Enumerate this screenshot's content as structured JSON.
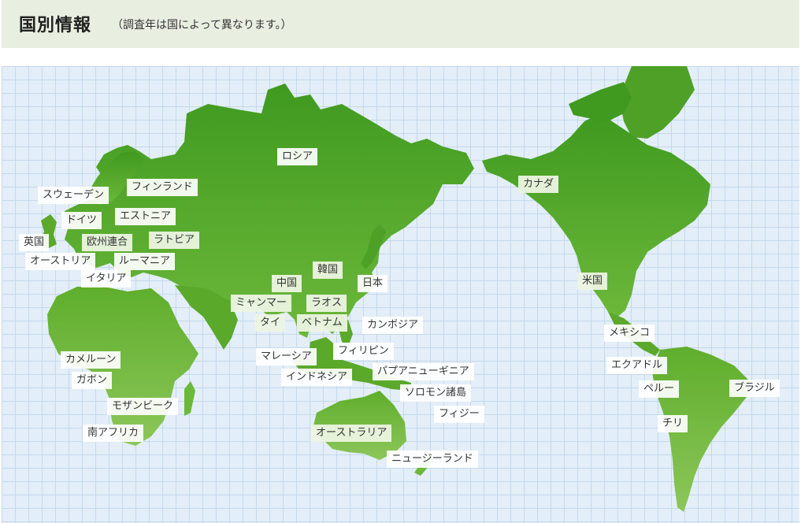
{
  "header": {
    "title": "国別情報",
    "subtitle": "（調査年は国によって異なります。）"
  },
  "colors": {
    "land_dark": "#3f9a1f",
    "land_mid": "#5fb02c",
    "land_light": "#8ec95a",
    "ocean": "#e3eef8",
    "header_bg": "#e8efe1"
  },
  "countries": [
    {
      "id": "russia",
      "label": "ロシア"
    },
    {
      "id": "finland",
      "label": "フィンランド"
    },
    {
      "id": "sweden",
      "label": "スウェーデン"
    },
    {
      "id": "estonia",
      "label": "エストニア"
    },
    {
      "id": "germany",
      "label": "ドイツ"
    },
    {
      "id": "uk",
      "label": "英国"
    },
    {
      "id": "eu",
      "label": "欧州連合"
    },
    {
      "id": "latvia",
      "label": "ラトビア"
    },
    {
      "id": "austria",
      "label": "オーストリア"
    },
    {
      "id": "romania",
      "label": "ルーマニア"
    },
    {
      "id": "italy",
      "label": "イタリア"
    },
    {
      "id": "korea",
      "label": "韓国"
    },
    {
      "id": "china",
      "label": "中国"
    },
    {
      "id": "japan",
      "label": "日本"
    },
    {
      "id": "myanmar",
      "label": "ミャンマー"
    },
    {
      "id": "laos",
      "label": "ラオス"
    },
    {
      "id": "thailand",
      "label": "タイ"
    },
    {
      "id": "vietnam",
      "label": "ベトナム"
    },
    {
      "id": "cambodia",
      "label": "カンボジア"
    },
    {
      "id": "malaysia",
      "label": "マレーシア"
    },
    {
      "id": "philippines",
      "label": "フィリピン"
    },
    {
      "id": "indonesia",
      "label": "インドネシア"
    },
    {
      "id": "png",
      "label": "パプアニューギニア"
    },
    {
      "id": "solomon",
      "label": "ソロモン諸島"
    },
    {
      "id": "fiji",
      "label": "フィジー"
    },
    {
      "id": "australia",
      "label": "オーストラリア"
    },
    {
      "id": "newzealand",
      "label": "ニュージーランド"
    },
    {
      "id": "cameroon",
      "label": "カメルーン"
    },
    {
      "id": "gabon",
      "label": "ガボン"
    },
    {
      "id": "mozambique",
      "label": "モザンビーク"
    },
    {
      "id": "southafrica",
      "label": "南アフリカ"
    },
    {
      "id": "canada",
      "label": "カナダ"
    },
    {
      "id": "usa",
      "label": "米国"
    },
    {
      "id": "mexico",
      "label": "メキシコ"
    },
    {
      "id": "ecuador",
      "label": "エクアドル"
    },
    {
      "id": "peru",
      "label": "ペルー"
    },
    {
      "id": "brazil",
      "label": "ブラジル"
    },
    {
      "id": "chile",
      "label": "チリ"
    }
  ]
}
